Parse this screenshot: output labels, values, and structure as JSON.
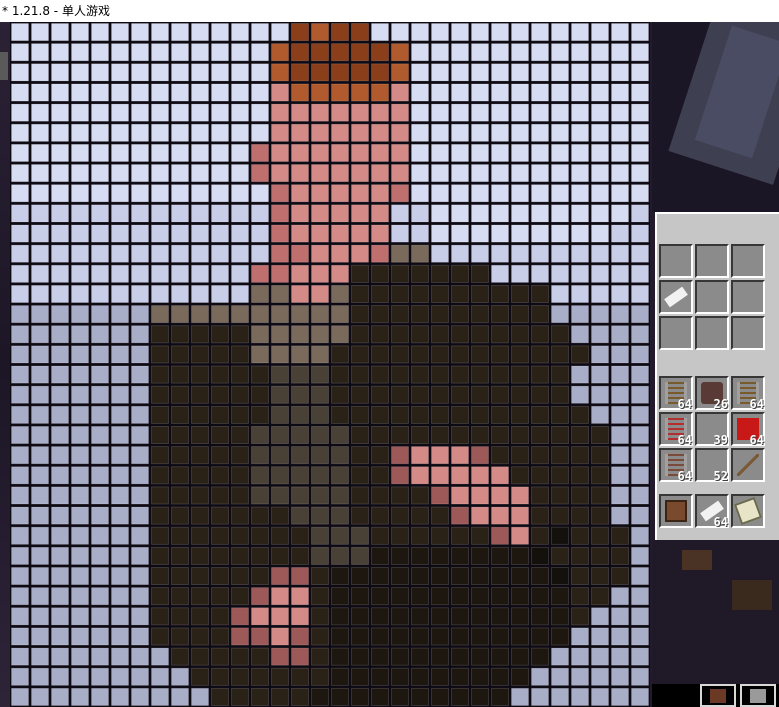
{
  "window": {
    "title": "* 1.21.8 - 单人游戏"
  },
  "mosaic": {
    "rows": 34,
    "cols": 32,
    "palette": {
      "s": "#c8cde8",
      "S": "#d6dcf2",
      "l": "#a9aec8",
      "p": "#c06f6f",
      "P": "#d48a86",
      "o": "#b15a2e",
      "O": "#8a3f1a",
      "d": "#2a2117",
      "D": "#1d170f",
      "g": "#4a4136",
      "m": "#7a6a5c",
      "r": "#9d5858",
      "k": "#14110c"
    },
    "grid": [
      "SSSSSSSSSSSSSSOoOOSSSSSSSSSSSSSS",
      "SSSSSSSSSSSSSoOOOOOoSSSSSSSSSSSS",
      "SSSSSSSSSSSSSoOOOOOoSSSSSSSSSSSS",
      "SSSSSSSSSSSSSPoooooPSSSSSSSSSSSS",
      "SSSSSSSSSSSSSPPPPPPPSSSSSSSSSSSS",
      "SSSSSSSSSSSSSPPPPPPPSSSSSSSSSSSS",
      "SSSSSSSSSSSSpPPPPPPPSSSSSSSSSSSS",
      "SSSSSSSSSSSSpPPPPPPPSSSSSSSSSSSS",
      "SSSSSSSSSSSSSpPPPPPpSSSSSSSSSSSS",
      "ssssssssssssspPPPPPssSSSSSSSSSSs",
      "ssssssssssssspPPPPPssSSSSSSSSSss",
      "sssssssssssssppPPPpmmssssssssss",
      "ssssssssssssppPPPdddddddssssssss",
      "ssssssssssssmmPPmddddddddddsssss",
      "lllllllmmmmmmmmmmddddddddddlllll",
      "llllllldddddmmmmmdddddddddddllll",
      "llllllldddddmmmmdddddddddddddlll",
      "lllllllddddddgggddddddddddddllll",
      "lllllllddddddgggddddddddddddllll",
      "lllllllddddddgggdddddddddddddlll",
      "llllllldddddgggggdddddddddddddll",
      "llllllldddddgggggddrPPPrddddddll",
      "llllllldddddgggggddrPPPPPdddddll",
      "llllllldddddgggggddddrPPPPddddll",
      "llllllldddddddgggdddddrPPPddddll",
      "lllllllddddddddgggddddddrPdkdddl",
      "lllllllddddddddgggDDDDDDDDkddddl",
      "lllllllddddddrrdDDDDDDDDDDDkdddl",
      "llllllldddddrPPdDDDDDDDDDDDDddll",
      "lllllllddddrPPPdDDDDDDDDDDDDdlll",
      "lllllllddddrrPrdDDDDDDDDDDDDllll",
      "lllllllldddddrrdDDDDDDDDDDDlllll",
      "llllllllldddddddDDDDDDDDDDllllll",
      "lllllllllldddddDDDDDDDDDDlllllll"
    ]
  },
  "panel": {
    "grid_slots": [
      {
        "item": "empty"
      },
      {
        "item": "empty"
      },
      {
        "item": "empty"
      },
      {
        "item": "paper-icon"
      },
      {
        "item": "empty"
      },
      {
        "item": "empty"
      },
      {
        "item": "empty"
      },
      {
        "item": "empty"
      },
      {
        "item": "empty"
      }
    ],
    "inventory": [
      {
        "item": "rail-icon",
        "count": "64"
      },
      {
        "item": "redstone-block-icon",
        "count": "26"
      },
      {
        "item": "rail-icon",
        "count": "64"
      },
      {
        "item": "powered-rail-icon",
        "count": "64"
      },
      {
        "item": "empty",
        "count": "39"
      },
      {
        "item": "redstone-icon",
        "count": "64"
      },
      {
        "item": "detector-rail-icon",
        "count": "64"
      },
      {
        "item": "empty",
        "count": "52"
      },
      {
        "item": "fishing-rod-icon",
        "count": ""
      }
    ],
    "hotbar_row": [
      {
        "item": "note-block-icon",
        "count": ""
      },
      {
        "item": "paper-icon",
        "count": "64"
      },
      {
        "item": "map-icon",
        "count": ""
      }
    ]
  },
  "colors": {
    "panel_bg": "#c6c6c6",
    "slot_bg": "#8b8b8b",
    "slot_dark": "#373737",
    "slot_light": "#ffffff"
  }
}
